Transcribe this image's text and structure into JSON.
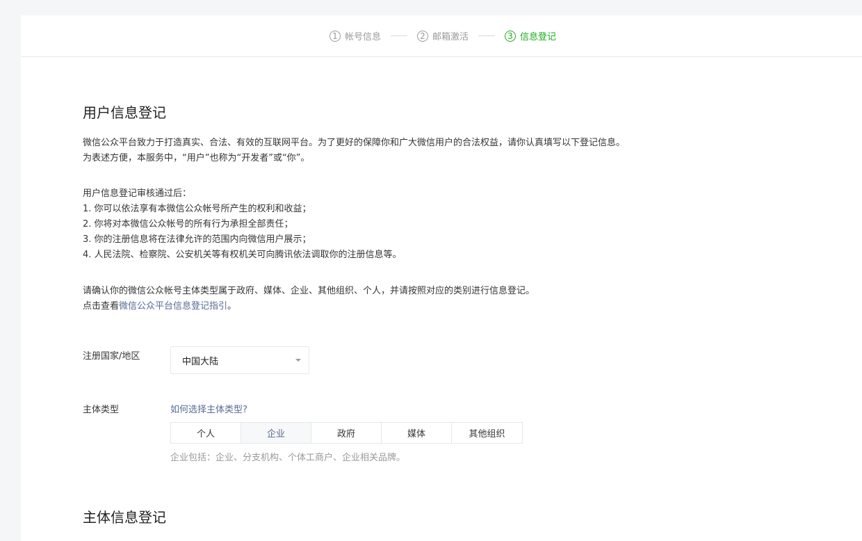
{
  "steps": [
    {
      "num": "1",
      "label": "帐号信息"
    },
    {
      "num": "2",
      "label": "邮箱激活"
    },
    {
      "num": "3",
      "label": "信息登记"
    }
  ],
  "section1": {
    "title": "用户信息登记",
    "intro_line1": "微信公众平台致力于打造真实、合法、有效的互联网平台。为了更好的保障你和广大微信用户的合法权益，请你认真填写以下登记信息。",
    "intro_line2": "为表述方便，本服务中，“用户”也称为“开发者”或“你”。",
    "after_title": "用户信息登记审核通过后：",
    "items": [
      "1. 你可以依法享有本微信公众帐号所产生的权利和收益；",
      "2. 你将对本微信公众帐号的所有行为承担全部责任；",
      "3. 你的注册信息将在法律允许的范围内向微信用户展示；",
      "4. 人民法院、检察院、公安机关等有权机关可向腾讯依法调取你的注册信息等。"
    ],
    "confirm_line": "请确认你的微信公众帐号主体类型属于政府、媒体、企业、其他组织、个人，并请按照对应的类别进行信息登记。",
    "guide_prefix": "点击查看",
    "guide_link": "微信公众平台信息登记指引",
    "guide_suffix": "。"
  },
  "form": {
    "country_label": "注册国家/地区",
    "country_value": "中国大陆",
    "type_label": "主体类型",
    "type_help_link": "如何选择主体类型?",
    "type_options": [
      "个人",
      "企业",
      "政府",
      "媒体",
      "其他组织"
    ],
    "selected_type": "企业",
    "type_hint": "企业包括：企业、分支机构、个体工商户、企业相关品牌。"
  },
  "section2": {
    "title": "主体信息登记"
  },
  "colors": {
    "accent_green": "#1aad19",
    "link_blue": "#576b95",
    "muted": "#9a9a9a"
  }
}
